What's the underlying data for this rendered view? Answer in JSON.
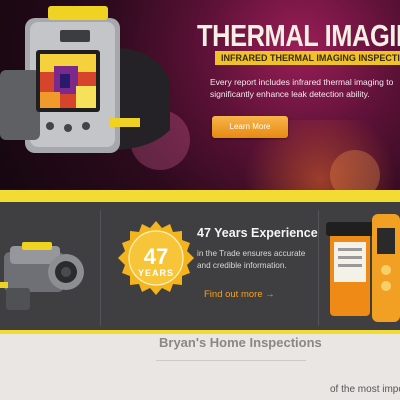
{
  "hero": {
    "title": "THERMAL IMAGING",
    "subtitle": "INFRARED THERMAL IMAGING INSPECTIONS",
    "body": "Every report includes infrared thermal imaging to significantly enhance leak detection ability.",
    "button_label": "Learn More"
  },
  "experience": {
    "badge_number": "47",
    "badge_label": "YEARS",
    "title": "47 Years Experience",
    "body": "in the Trade ensures accurate and credible information.",
    "link_label": "Find out more →"
  },
  "about": {
    "title": "Bryan's Home Inspections",
    "text_fragment": "of the most import"
  },
  "colors": {
    "accent_yellow": "#f2dc33",
    "button_orange": "#f29a1f",
    "band_dark": "#3f3e40"
  }
}
